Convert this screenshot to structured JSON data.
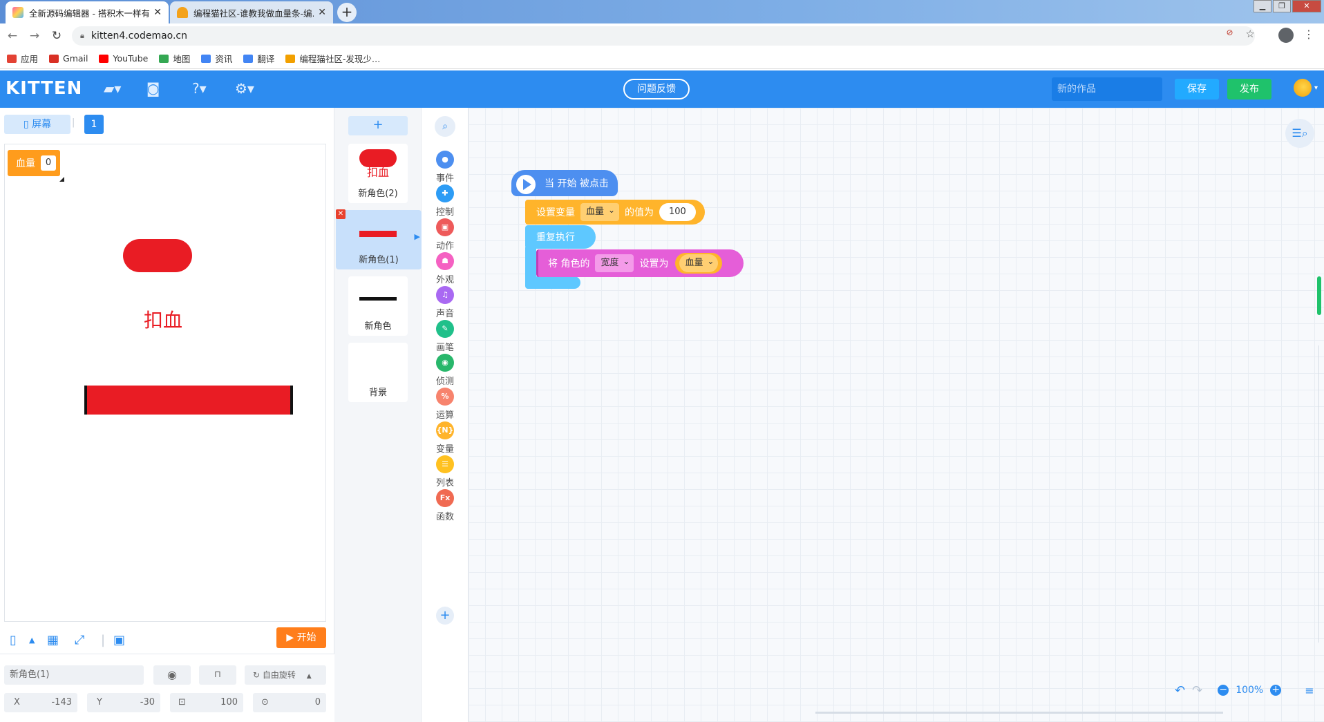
{
  "browser": {
    "tabs": [
      {
        "title": "全新源码编辑器 - 搭积木一样有…",
        "close": "✕"
      },
      {
        "title": "编程猫社区-谁教我做血量条-编…",
        "close": "✕"
      }
    ],
    "new_tab": "+",
    "url": "kitten4.codemao.cn",
    "bookmarks": [
      {
        "label": "应用",
        "color": "#e34234"
      },
      {
        "label": "Gmail",
        "color": "#d93025"
      },
      {
        "label": "YouTube",
        "color": "#ff0000"
      },
      {
        "label": "地图",
        "color": "#34a853"
      },
      {
        "label": "资讯",
        "color": "#4285f4"
      },
      {
        "label": "翻译",
        "color": "#4285f4"
      },
      {
        "label": "编程猫社区-发现少…",
        "color": "#f2a000"
      }
    ]
  },
  "header": {
    "logo": "KITTEN",
    "feedback": "问题反馈",
    "work_name": "新的作品",
    "save": "保存",
    "publish": "发布"
  },
  "stage": {
    "screen_button": "屏幕",
    "screen_number": "1",
    "variable_name": "血量",
    "variable_value": "0",
    "sprite_text": "扣血",
    "start_button": "开始"
  },
  "properties": {
    "sprite_name": "新角色(1)",
    "rotation_mode": "自由旋转",
    "x_label": "X",
    "x_value": "-143",
    "y_label": "Y",
    "y_value": "-30",
    "size_value": "100",
    "direction_value": "0"
  },
  "sprites": {
    "add": "+",
    "items": [
      {
        "label": "新角色(2)",
        "thumb_text": "扣血"
      },
      {
        "label": "新角色(1)"
      },
      {
        "label": "新角色"
      },
      {
        "label": "背景"
      }
    ]
  },
  "categories": [
    {
      "label": "事件",
      "color": "#4d8ff0",
      "glyph": "●"
    },
    {
      "label": "控制",
      "color": "#2d9cf5",
      "glyph": "✚"
    },
    {
      "label": "动作",
      "color": "#ee5a5a",
      "glyph": "▣"
    },
    {
      "label": "外观",
      "color": "#f561c2",
      "glyph": "☗"
    },
    {
      "label": "声音",
      "color": "#a969f2",
      "glyph": "♫"
    },
    {
      "label": "画笔",
      "color": "#20c08a",
      "glyph": "✎"
    },
    {
      "label": "侦测",
      "color": "#28b76b",
      "glyph": "◉"
    },
    {
      "label": "运算",
      "color": "#f7836d",
      "glyph": "%"
    },
    {
      "label": "变量",
      "color": "#ffb42b",
      "glyph": "{N}"
    },
    {
      "label": "列表",
      "color": "#ffc120",
      "glyph": "☰"
    },
    {
      "label": "函数",
      "color": "#f06a52",
      "glyph": "Fx"
    }
  ],
  "blocks": {
    "when_start": "当 开始 被点击",
    "set_variable": "设置变量",
    "set_var_dropdown": "血量",
    "value_to": "的值为",
    "value": "100",
    "repeat_forever": "重复执行",
    "set_prop_prefix": "将 角色的",
    "prop_dropdown": "宽度",
    "set_to": "设置为",
    "var_reporter": "血量"
  },
  "zoom": "100%"
}
